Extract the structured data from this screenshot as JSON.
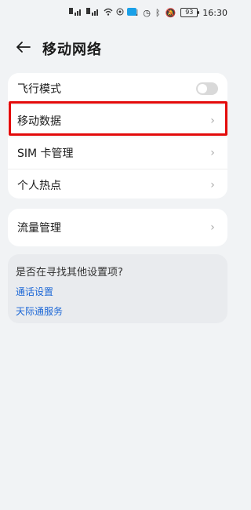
{
  "status_bar": {
    "time": "16:30",
    "battery": "93"
  },
  "header": {
    "title": "移动网络"
  },
  "main_card": {
    "items": [
      {
        "label": "飞行模式",
        "type": "toggle",
        "toggle_on": false
      },
      {
        "label": "移动数据",
        "type": "nav"
      },
      {
        "label": "SIM 卡管理",
        "type": "nav"
      },
      {
        "label": "个人热点",
        "type": "nav"
      }
    ]
  },
  "flow_card": {
    "label": "流量管理"
  },
  "suggest": {
    "title": "是否在寻找其他设置项?",
    "links": [
      "通话设置",
      "天际通服务"
    ]
  },
  "colors": {
    "highlight": "#e30b0b",
    "link": "#1c67d6"
  }
}
